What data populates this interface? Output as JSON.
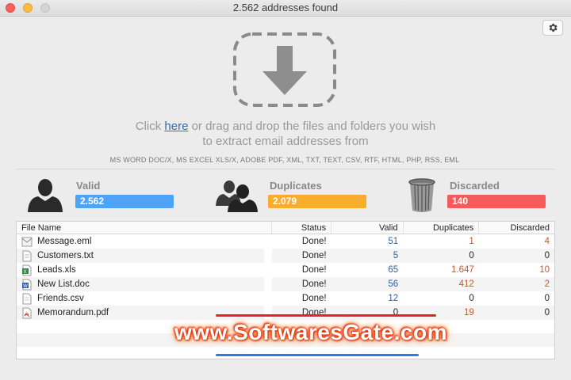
{
  "window": {
    "title": "2.562 addresses found"
  },
  "drop": {
    "prefix": "Click ",
    "link": "here",
    "suffix_line1": " or drag and drop the files and folders you wish",
    "line2": "to extract email addresses from",
    "formats": "MS WORD DOC/X, MS EXCEL XLS/X, ADOBE PDF, XML, TXT, TEXT, CSV, RTF, HTML, PHP, RSS, EML"
  },
  "stats": {
    "valid": {
      "label": "Valid",
      "value": "2.562",
      "color": "#4fa3f7"
    },
    "duplicates": {
      "label": "Duplicates",
      "value": "2.079",
      "color": "#f9ad2e"
    },
    "discarded": {
      "label": "Discarded",
      "value": "140",
      "color": "#f45b5b"
    }
  },
  "table": {
    "headers": {
      "name": "File Name",
      "status": "Status",
      "valid": "Valid",
      "duplicates": "Duplicates",
      "discarded": "Discarded"
    },
    "rows": [
      {
        "name": "Message.eml",
        "icon": "email-file-icon",
        "status": "Done!",
        "valid": "51",
        "duplicates": "1",
        "discarded": "4"
      },
      {
        "name": "Customers.txt",
        "icon": "text-file-icon",
        "status": "Done!",
        "valid": "5",
        "duplicates": "0",
        "discarded": "0"
      },
      {
        "name": "Leads.xls",
        "icon": "excel-file-icon",
        "status": "Done!",
        "valid": "65",
        "duplicates": "1.647",
        "discarded": "10"
      },
      {
        "name": "New List.doc",
        "icon": "word-file-icon",
        "status": "Done!",
        "valid": "56",
        "duplicates": "412",
        "discarded": "2"
      },
      {
        "name": "Friends.csv",
        "icon": "csv-file-icon",
        "status": "Done!",
        "valid": "12",
        "duplicates": "0",
        "discarded": "0"
      },
      {
        "name": "Memorandum.pdf",
        "icon": "pdf-file-icon",
        "status": "Done!",
        "valid": "0",
        "duplicates": "19",
        "discarded": "0"
      }
    ]
  },
  "watermark": "www.SoftwaresGate.com"
}
